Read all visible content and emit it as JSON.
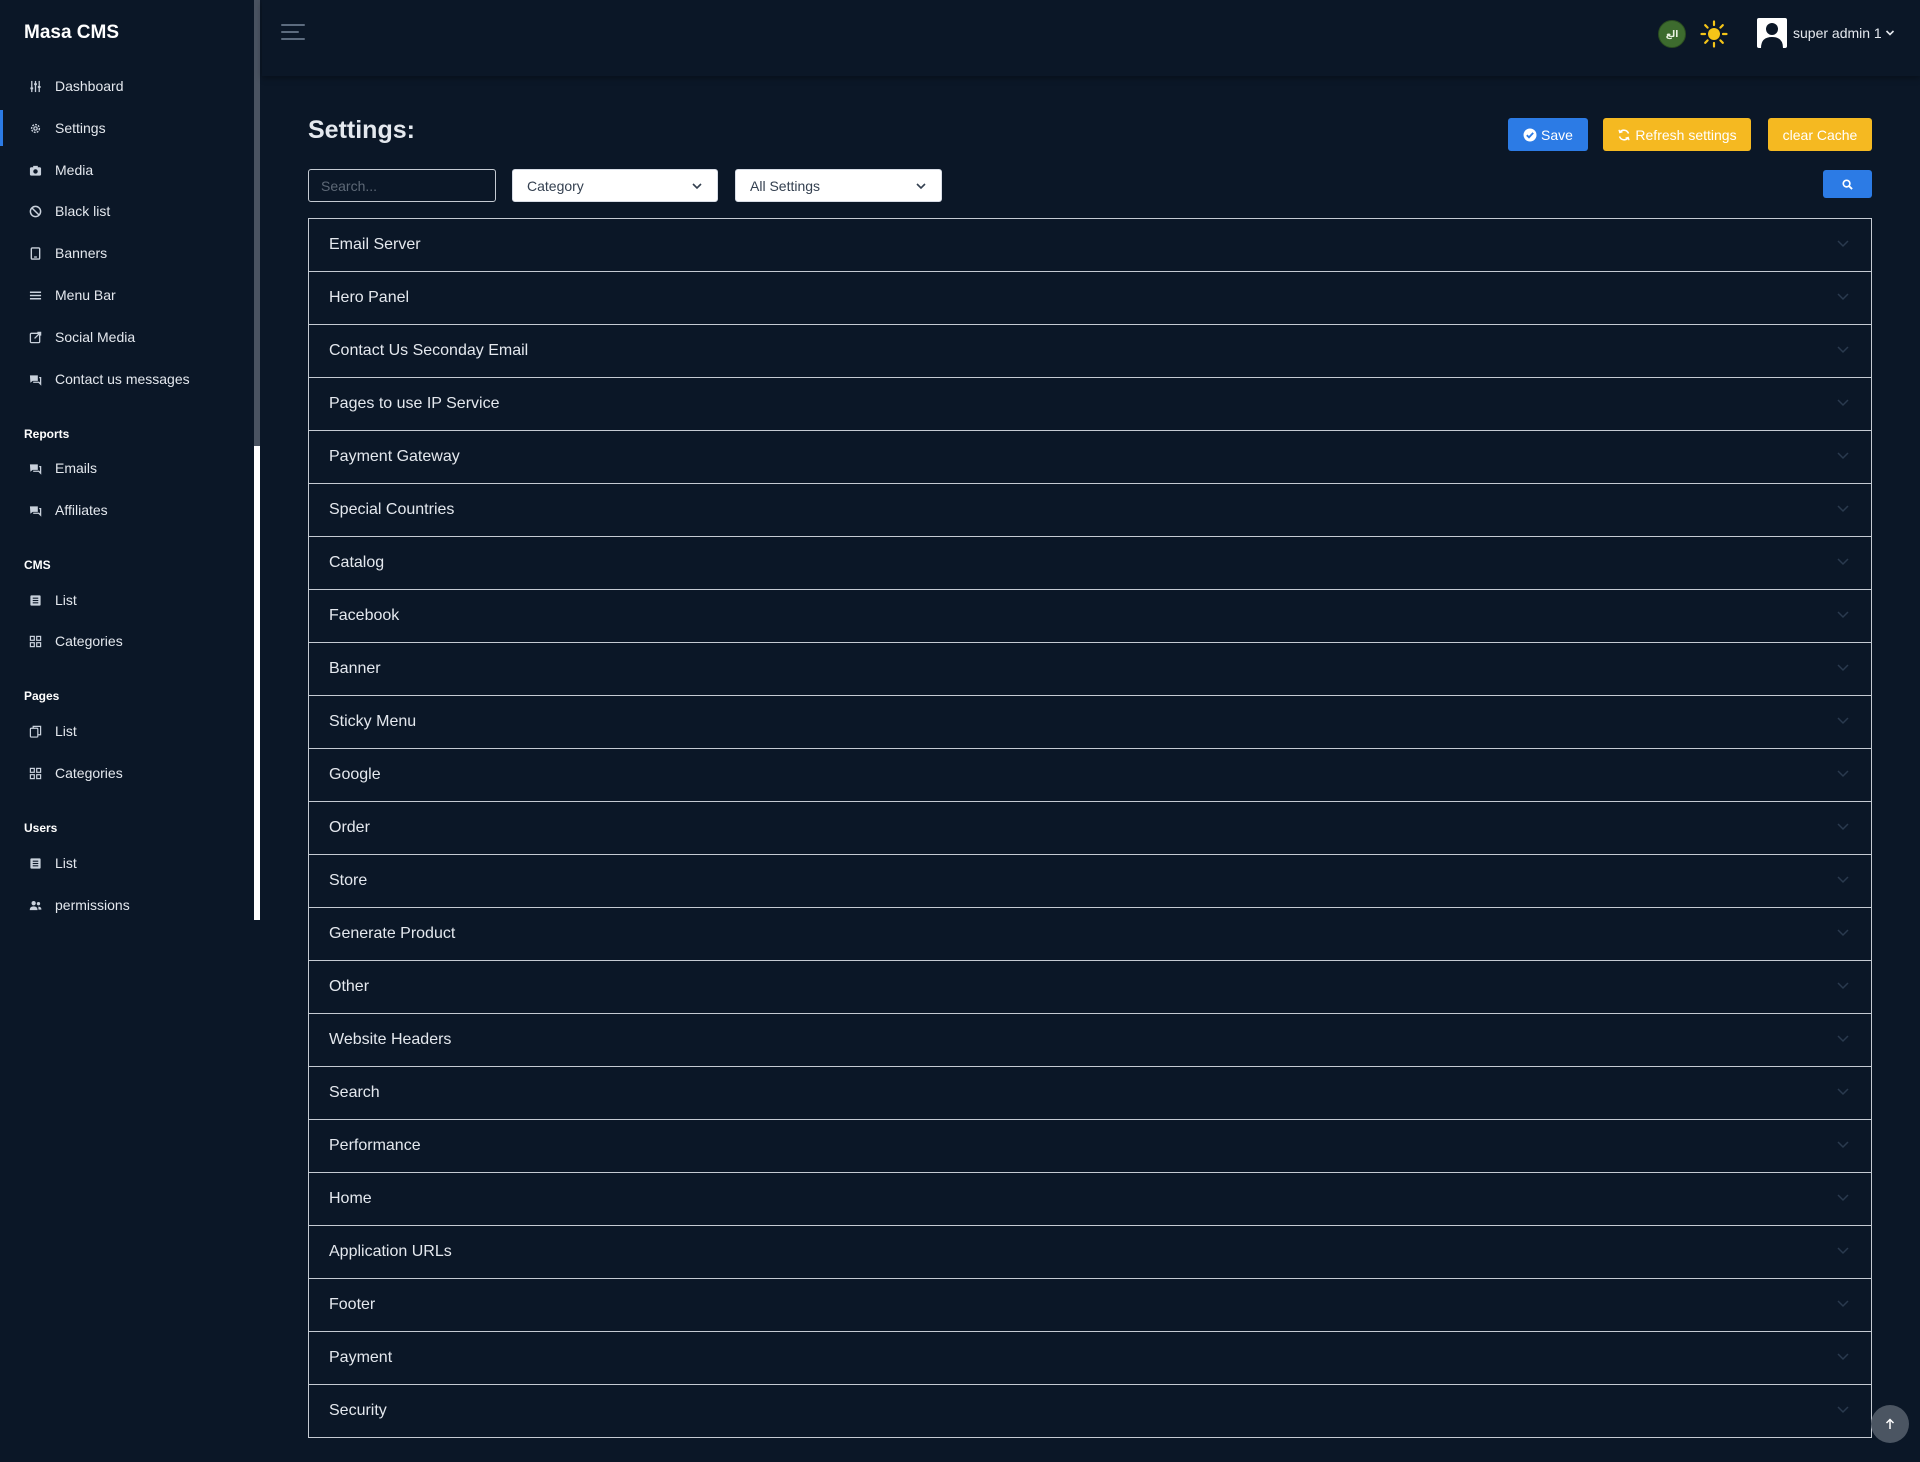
{
  "app": {
    "brand": "Masa CMS"
  },
  "sidebar": {
    "items": [
      {
        "label": "Dashboard",
        "icon": "sliders-icon"
      },
      {
        "label": "Settings",
        "icon": "gear-icon",
        "active": true
      },
      {
        "label": "Media",
        "icon": "camera-icon"
      },
      {
        "label": "Black list",
        "icon": "ban-icon"
      },
      {
        "label": "Banners",
        "icon": "tablet-icon"
      },
      {
        "label": "Menu Bar",
        "icon": "bars-icon"
      },
      {
        "label": "Social Media",
        "icon": "share-square-icon"
      },
      {
        "label": "Contact us messages",
        "icon": "comments-icon"
      }
    ],
    "sections": {
      "reports": {
        "title": "Reports",
        "items": [
          {
            "label": "Emails",
            "icon": "comments-icon"
          },
          {
            "label": "Affiliates",
            "icon": "comments-icon"
          }
        ]
      },
      "cms": {
        "title": "CMS",
        "items": [
          {
            "label": "List",
            "icon": "list-icon"
          },
          {
            "label": "Categories",
            "icon": "grid-icon"
          }
        ]
      },
      "pages": {
        "title": "Pages",
        "items": [
          {
            "label": "List",
            "icon": "copy-icon"
          },
          {
            "label": "Categories",
            "icon": "grid-icon"
          }
        ]
      },
      "users": {
        "title": "Users",
        "items": [
          {
            "label": "List",
            "icon": "list-icon"
          },
          {
            "label": "permissions",
            "icon": "users-icon"
          }
        ]
      }
    }
  },
  "topbar": {
    "flag_text": "الع",
    "user_name": "super admin 1"
  },
  "main": {
    "title": "Settings:",
    "buttons": {
      "save": "Save",
      "refresh": "Refresh settings",
      "clear": "clear Cache"
    },
    "search": {
      "placeholder": "Search..."
    },
    "selects": {
      "category": "Category",
      "all_settings": "All Settings"
    },
    "accordion": [
      "Email Server",
      "Hero Panel",
      "Contact Us Seconday Email",
      "Pages to use IP Service",
      "Payment Gateway",
      "Special Countries",
      "Catalog",
      "Facebook",
      "Banner",
      "Sticky Menu",
      "Google",
      "Order",
      "Store",
      "Generate Product",
      "Other",
      "Website Headers",
      "Search",
      "Performance",
      "Home",
      "Application URLs",
      "Footer",
      "Payment",
      "Security"
    ]
  },
  "colors": {
    "background": "#0b1727",
    "primary": "#2c7be5",
    "warning": "#f5b921",
    "border": "#c5cbd3"
  }
}
